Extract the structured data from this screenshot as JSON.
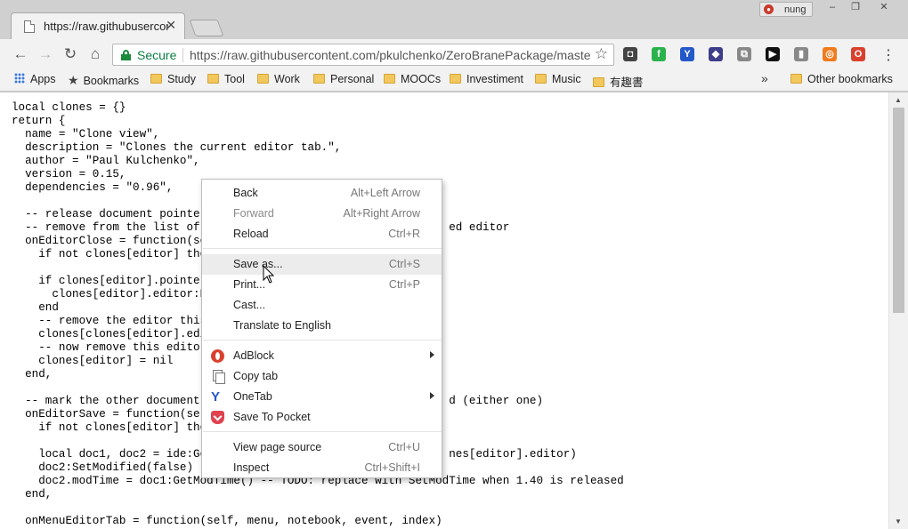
{
  "browser": {
    "tab_title": "https://raw.githubusercontent.com/pkulchenko",
    "tab_close": "✕",
    "profile_name": "nung",
    "window_buttons": [
      "–",
      "❐",
      "✕"
    ]
  },
  "toolbar": {
    "back": "←",
    "forward": "→",
    "reload": "↻",
    "home": "⌂",
    "secure_label": "Secure",
    "url": "https://raw.githubusercontent.com/pkulchenko/ZeroBranePackage/master/clonetab.lua",
    "star": "☆",
    "menu": "⋮",
    "extensions": [
      {
        "name": "pocket-icon",
        "glyph": "◘",
        "color": "#444444"
      },
      {
        "name": "feedly-icon",
        "glyph": "f",
        "color": "#2bb24c"
      },
      {
        "name": "onetab-icon",
        "glyph": "Y",
        "color": "#2458c9"
      },
      {
        "name": "extension-icon",
        "glyph": "◆",
        "color": "#3d3d8a"
      },
      {
        "name": "copy-tab-icon",
        "glyph": "⧉",
        "color": "#888888"
      },
      {
        "name": "terminal-icon",
        "glyph": "▶",
        "color": "#111111"
      },
      {
        "name": "reader-icon",
        "glyph": "▮",
        "color": "#888888"
      },
      {
        "name": "circle-extension-icon",
        "glyph": "◎",
        "color": "#f07b1d"
      },
      {
        "name": "adblock-icon",
        "glyph": "O",
        "color": "#d9412e"
      }
    ]
  },
  "bookmarks": {
    "apps": "Apps",
    "items": [
      "Bookmarks",
      "Study",
      "Tool",
      "Work",
      "Personal",
      "MOOCs",
      "Investiment",
      "Music",
      "有趣書"
    ],
    "more": "»",
    "other": "Other bookmarks"
  },
  "code_lines": [
    "local clones = {}",
    "return {",
    "  name = \"Clone view\",",
    "  description = \"Clones the current editor tab.\",",
    "  author = \"Paul Kulchenko\",",
    "  version = 0.15,",
    "  dependencies = \"0.96\",",
    "",
    "  -- release document pointer",
    "  -- remove from the list of c                                   ed editor",
    "  onEditorClose = function(sel",
    "    if not clones[editor] ther",
    "",
    "    if clones[editor].pointer",
    "      clones[editor].editor:Re",
    "    end",
    "    -- remove the editor this",
    "    clones[clones[editor].edit",
    "    -- now remove this editor",
    "    clones[editor] = nil",
    "  end,",
    "",
    "  -- mark the other document a                                   d (either one)",
    "  onEditorSave = function(self",
    "    if not clones[editor] ther",
    "",
    "    local doc1, doc2 = ide:Get                                   nes[editor].editor)",
    "    doc2:SetModified(false)",
    "    doc2.modTime = doc1:GetModTime() -- TODO: replace with SetModTime when 1.40 is released",
    "  end,",
    "",
    "  onMenuEditorTab = function(self, menu, notebook, event, index)"
  ],
  "context_menu": {
    "back": {
      "label": "Back",
      "shortcut": "Alt+Left Arrow"
    },
    "forward": {
      "label": "Forward",
      "shortcut": "Alt+Right Arrow"
    },
    "reload": {
      "label": "Reload",
      "shortcut": "Ctrl+R"
    },
    "save_as": {
      "label": "Save as...",
      "shortcut": "Ctrl+S"
    },
    "print": {
      "label": "Print...",
      "shortcut": "Ctrl+P"
    },
    "cast": {
      "label": "Cast..."
    },
    "translate": {
      "label": "Translate to English"
    },
    "adblock": {
      "label": "AdBlock"
    },
    "copy_tab": {
      "label": "Copy tab"
    },
    "onetab": {
      "label": "OneTab"
    },
    "save_to_pocket": {
      "label": "Save To Pocket"
    },
    "view_source": {
      "label": "View page source",
      "shortcut": "Ctrl+U"
    },
    "inspect": {
      "label": "Inspect",
      "shortcut": "Ctrl+Shift+I"
    }
  },
  "scrollbar": {
    "up": "▲",
    "down": "▼"
  }
}
